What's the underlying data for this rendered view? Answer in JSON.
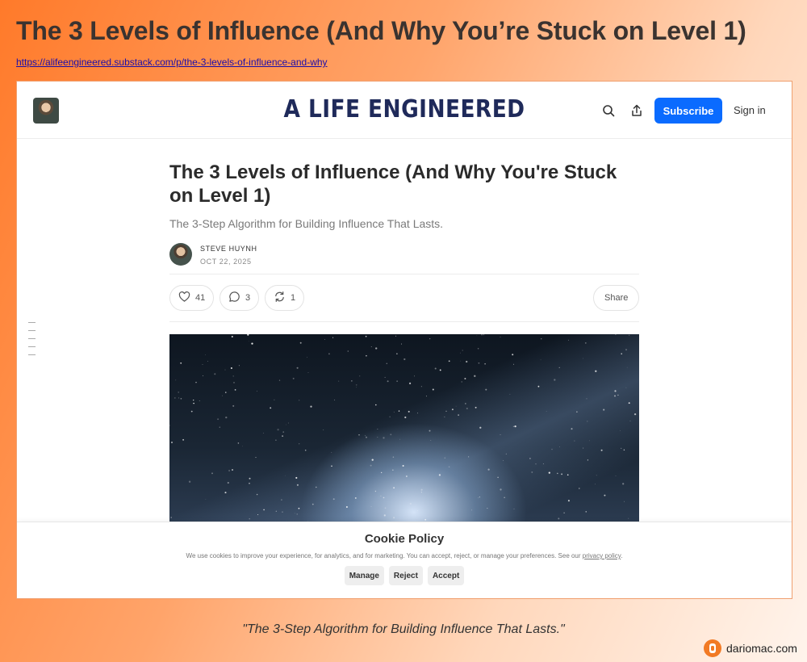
{
  "page": {
    "heading": "The 3 Levels of Influence (And Why You’re Stuck on Level 1)",
    "link": "https://alifeengineered.substack.com/p/the-3-levels-of-influence-and-why",
    "quote": "\"The 3-Step Algorithm for Building Influence That Lasts.\"",
    "footer_brand": "dariomac.com"
  },
  "header": {
    "brand": "A LIFE ENGINEERED",
    "subscribe_label": "Subscribe",
    "signin_label": "Sign in"
  },
  "article": {
    "title": "The 3 Levels of Influence (And Why You're Stuck on Level 1)",
    "subtitle": "The 3-Step Algorithm for Building Influence That Lasts.",
    "author": "STEVE HUYNH",
    "date": "OCT 22, 2025",
    "likes": "41",
    "comments": "3",
    "restacks": "1",
    "share_label": "Share"
  },
  "cookie": {
    "title": "Cookie Policy",
    "text": "We use cookies to improve your experience, for analytics, and for marketing. You can accept, reject, or manage your preferences. See our",
    "policy_link": "privacy policy",
    "manage": "Manage",
    "reject": "Reject",
    "accept": "Accept"
  },
  "colors": {
    "accent": "#0a6bff",
    "brand": "#1f2a5a",
    "footer_logo": "#f27a24"
  },
  "icons": [
    "search-icon",
    "share-icon",
    "heart-icon",
    "comment-icon",
    "restack-icon",
    "toc-icon"
  ]
}
